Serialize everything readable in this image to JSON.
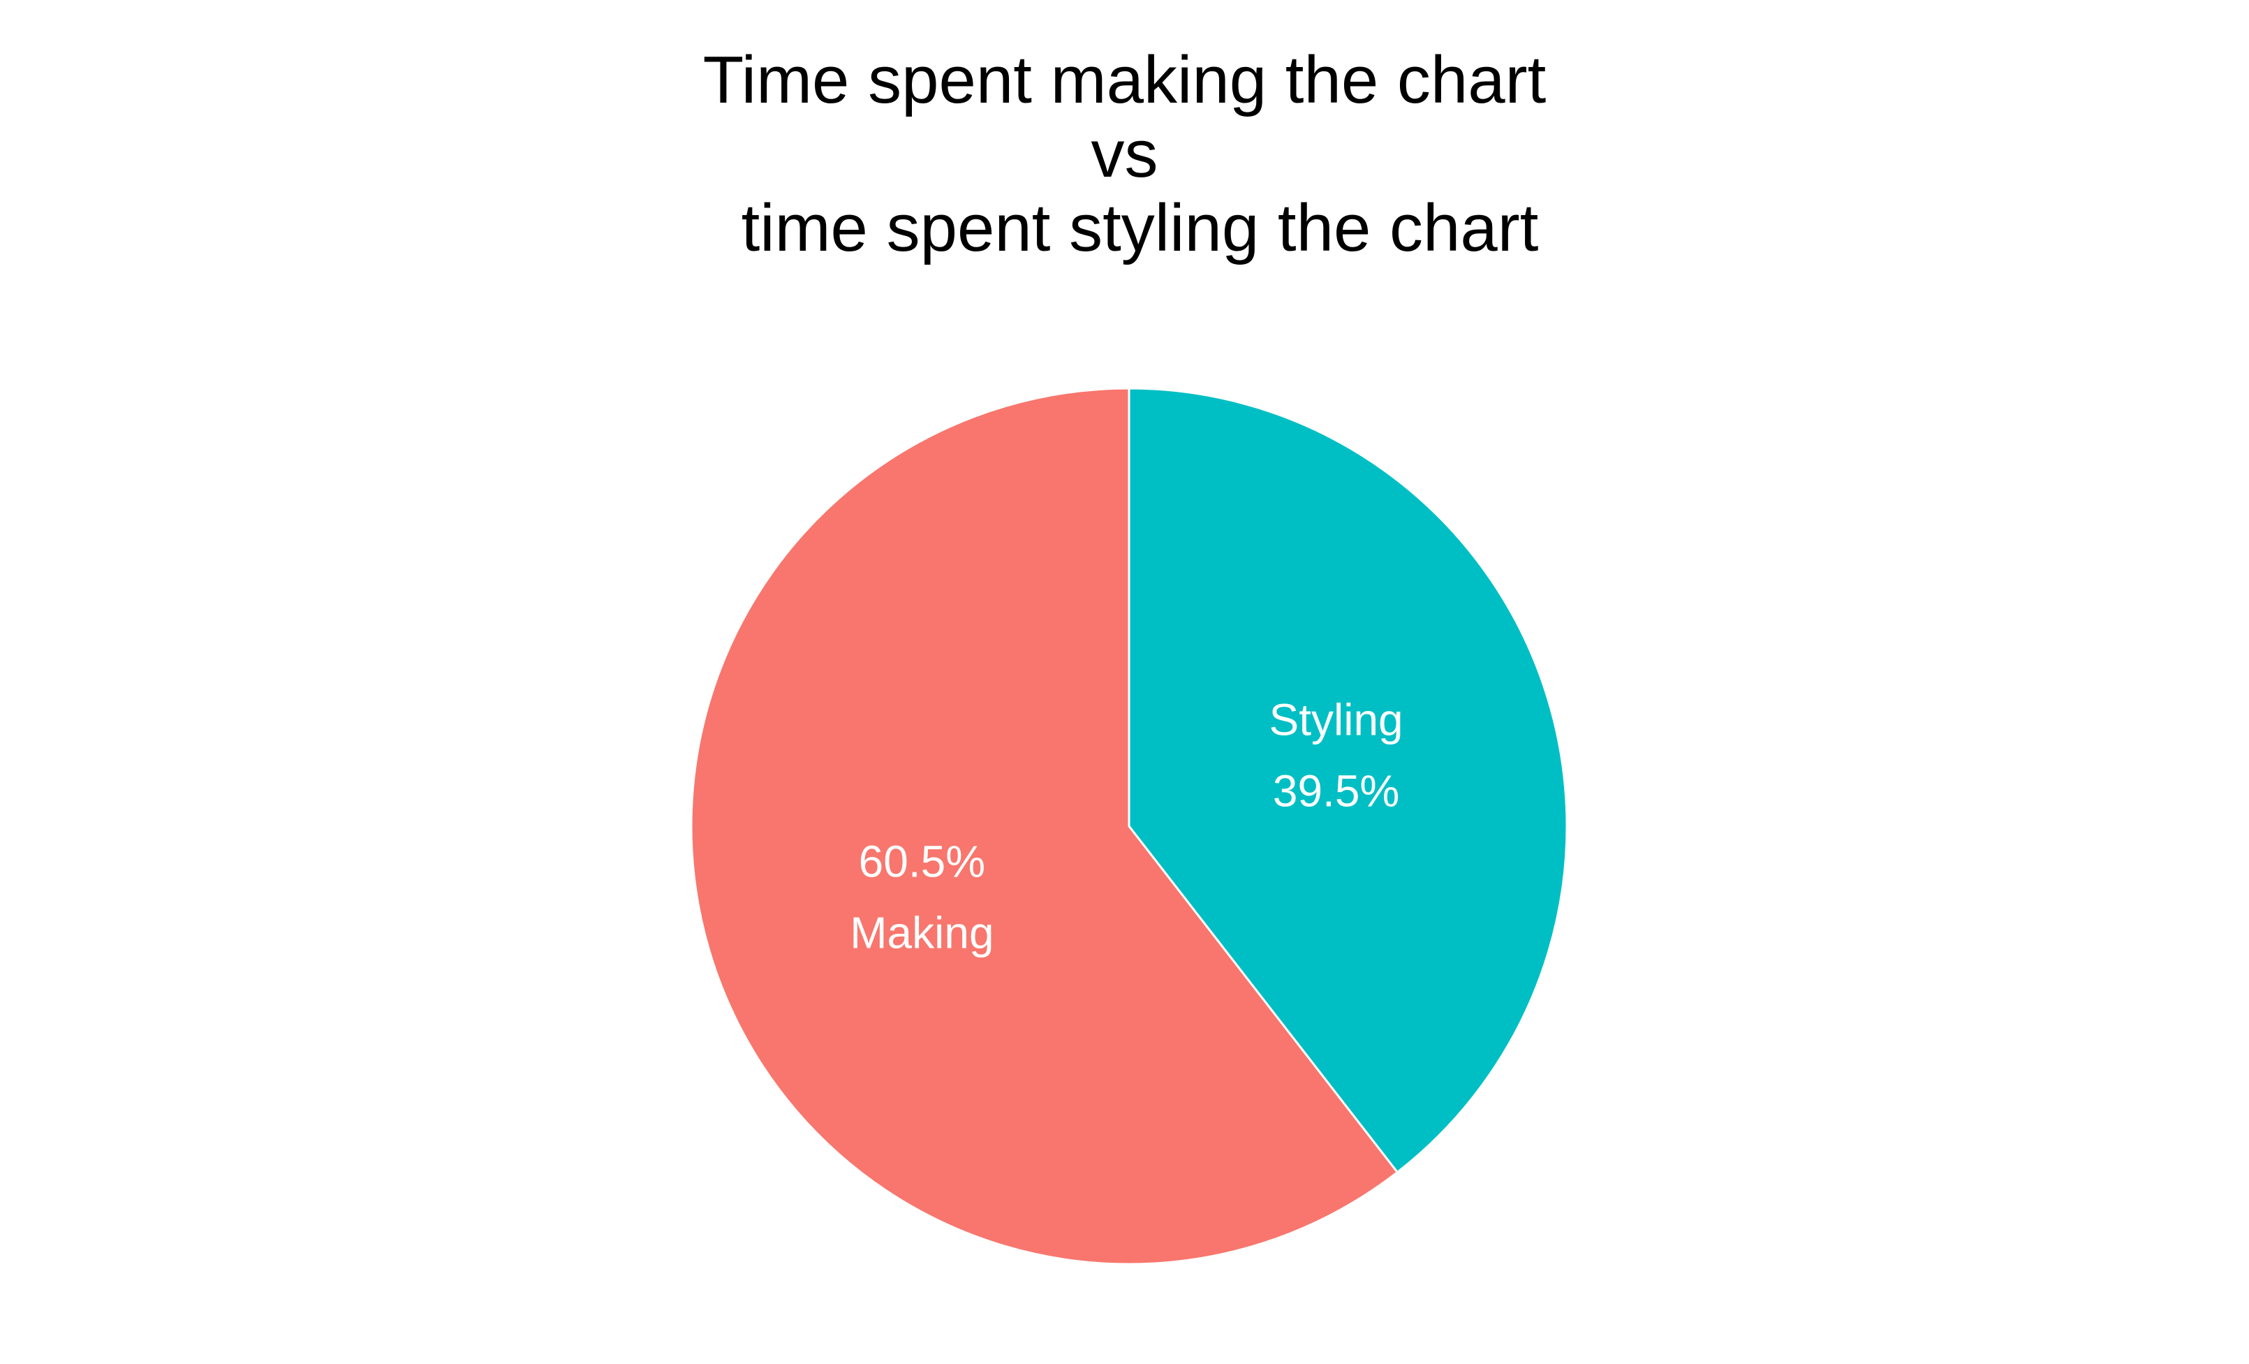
{
  "chart_data": {
    "type": "pie",
    "title_lines": [
      "Time spent making the chart",
      "vs",
      " time spent styling the chart"
    ],
    "slices": [
      {
        "name": "Styling",
        "value": 39.5,
        "label_lines": [
          "Styling",
          " 39.5%"
        ],
        "color": "#00BFC4"
      },
      {
        "name": "Making",
        "value": 60.5,
        "label_lines": [
          "60.5%",
          " Making"
        ],
        "color": "#F8766D"
      }
    ],
    "start": "12 o'clock",
    "direction": "clockwise",
    "legend": "none",
    "slice_border_color": "#ffffff"
  }
}
